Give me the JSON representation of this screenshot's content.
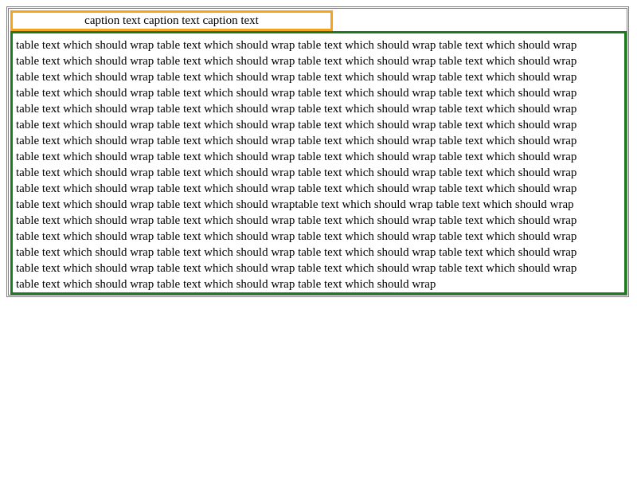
{
  "caption": {
    "text": "caption text caption text caption text"
  },
  "table": {
    "lines": [
      "table text which should wrap table text which should wrap table text which should wrap table text which should wrap",
      "table text which should wrap table text which should wrap table text which should wrap table text which should wrap",
      "table text which should wrap table text which should wrap table text which should wrap table text which should wrap",
      "table text which should wrap table text which should wrap table text which should wrap table text which should wrap",
      "table text which should wrap table text which should wrap table text which should wrap table text which should wrap",
      "table text which should wrap table text which should wrap table text which should wrap table text which should wrap",
      "table text which should wrap table text which should wrap table text which should wrap table text which should wrap",
      "table text which should wrap table text which should wrap table text which should wrap table text which should wrap",
      "table text which should wrap table text which should wrap table text which should wrap table text which should wrap",
      "table text which should wrap table text which should wrap table text which should wrap table text which should wrap",
      "table text which should wrap table text which should wraptable text which should wrap table text which should wrap",
      "table text which should wrap table text which should wrap table text which should wrap table text which should wrap",
      "table text which should wrap table text which should wrap table text which should wrap table text which should wrap",
      "table text which should wrap table text which should wrap table text which should wrap table text which should wrap",
      "table text which should wrap table text which should wrap table text which should wrap table text which should wrap",
      "table text which should wrap table text which should wrap table text which should wrap"
    ]
  },
  "colors": {
    "caption_border": "#f5a31a",
    "table_border": "#1f7a1f",
    "outer_border": "#808080"
  }
}
